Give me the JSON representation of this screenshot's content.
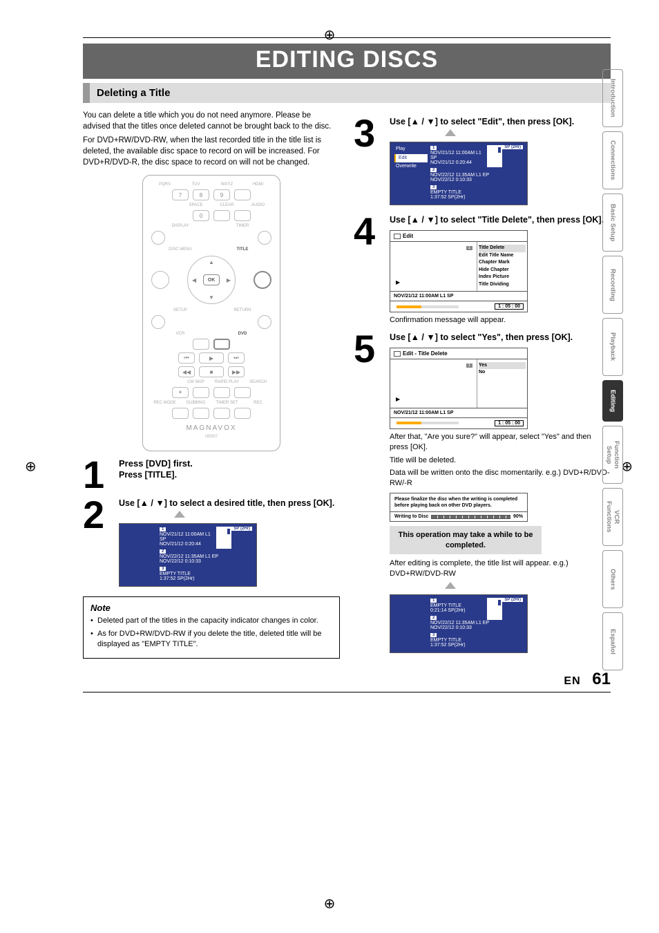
{
  "page": {
    "title": "EDITING DISCS",
    "section": "Deleting a Title",
    "lang_code": "EN",
    "page_number": "61"
  },
  "intro": {
    "p1": "You can delete a title which you do not need anymore. Please be advised that the titles once deleted cannot be brought back to the disc.",
    "p2": "For DVD+RW/DVD-RW, when the last recorded title in the title list is deleted, the available disc space to record on will be increased. For DVD+R/DVD-R, the disc space to record on will not be changed."
  },
  "remote": {
    "labels_row1": [
      "PQRS",
      "TUV",
      "WXYZ",
      "HDMI"
    ],
    "nums_row1": [
      "7",
      "8",
      "9",
      ""
    ],
    "labels_row2": [
      "",
      "SPACE",
      "CLEAR",
      "AUDIO"
    ],
    "nums_row2": [
      "",
      "0",
      "",
      ""
    ],
    "display": "DISPLAY",
    "timer": "TIMER",
    "disc_menu": "DISC MENU",
    "title": "TITLE",
    "ok": "OK",
    "setup": "SETUP",
    "ret": "RETURN",
    "vcr": "VCR",
    "dvd": "DVD",
    "row_a": [
      "⏮",
      "▶",
      "⏭"
    ],
    "row_b": [
      "◀◀",
      "■",
      "▶▶"
    ],
    "row_c": [
      "⏸",
      "",
      ""
    ],
    "labels_c": [
      "",
      "CM SKIP",
      "RAPID PLAY",
      "SEARCH"
    ],
    "labels_d": [
      "REC MODE",
      "DUBBING",
      "TIMER SET",
      "REC"
    ],
    "brand": "MAGNAVOX",
    "model": "NB887"
  },
  "steps": {
    "s0a": "Press [DVD] first.",
    "s1": "Press [TITLE].",
    "s2": "Use [▲ / ▼] to select a desired title, then press [OK].",
    "s3": "Use [▲ / ▼] to select \"Edit\", then press [OK].",
    "s4": "Use [▲ / ▼] to select \"Title Delete\", then press [OK].",
    "s4_sub": "Confirmation message will appear.",
    "s5": "Use [▲ / ▼] to select \"Yes\", then press [OK].",
    "s5_p1": "After that, \"Are you sure?\" will appear, select \"Yes\" and then press [OK].",
    "s5_p2": "Title will be deleted.",
    "s5_p3": "Data will be written onto the disc momentarily. e.g.) DVD+R/DVD-RW/-R",
    "s5_warn": "This operation may take a while to be completed.",
    "s5_p4": "After editing is complete, the title list will appear. e.g.) DVD+RW/DVD-RW"
  },
  "screens": {
    "list": {
      "sp": "SP (2Hr)",
      "side_play": "Play",
      "side_edit": "Edit",
      "side_over": "Overwrite",
      "r1a": "NOV/21/12   11:00AM L1 SP",
      "r1b": "NOV/21/12   0:20:44",
      "r2a": "NOV/22/12   11:35AM L1 EP",
      "r2b": "NOV/22/12   0:10:33",
      "r3a": "EMPTY TITLE",
      "r3b": "1:37:52  SP(2Hr)",
      "last_e1a": "EMPTY TITLE",
      "last_e1b": "0:21:14  SP(2Hr)",
      "n1": "1",
      "n2": "2",
      "n3": "3"
    },
    "edit_menu": {
      "title": "Edit",
      "items": [
        "Title Delete",
        "Edit Title Name",
        "Chapter Mark",
        "Hide Chapter",
        "Index Picture",
        "Title Dividing"
      ],
      "footer_info": "NOV/21/12 11:00AM L1 SP",
      "footer_time": "1 : 05 : 00",
      "num": "1"
    },
    "confirm": {
      "title": "Edit - Title Delete",
      "yes": "Yes",
      "no": "No",
      "footer_info": "NOV/21/12 11:00AM L1 SP",
      "footer_time": "1 : 05 : 00",
      "num": "1"
    },
    "finalize": {
      "msg": "Please finalize the disc when the writing is completed before playing back on other DVD players.",
      "label": "Writing to Disc",
      "pct": "90%"
    }
  },
  "note": {
    "head": "Note",
    "b1": "Deleted part of the titles in the capacity indicator changes in color.",
    "b2": "As for DVD+RW/DVD-RW if you delete the title, deleted title will be displayed as \"EMPTY TITLE\"."
  },
  "tabs": {
    "t1": "Introduction",
    "t2": "Connections",
    "t3": "Basic Setup",
    "t4": "Recording",
    "t5": "Playback",
    "t6": "Editing",
    "t7": "Function Setup",
    "t8": "VCR Functions",
    "t9": "Others",
    "t10": "Español"
  }
}
